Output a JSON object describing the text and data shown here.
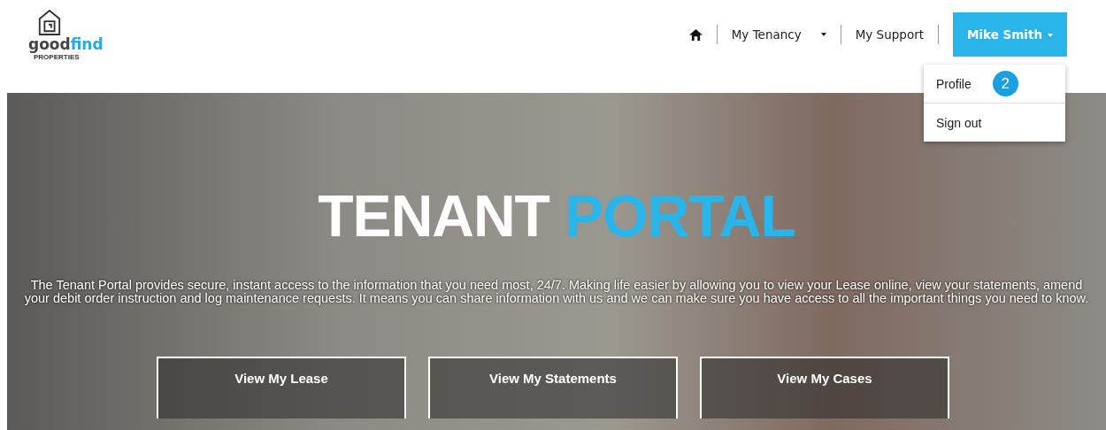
{
  "logo": {
    "word_dark": "good",
    "word_accent": "find",
    "tagline": "PROPERTIES"
  },
  "nav": {
    "items": [
      {
        "label": "My Tenancy",
        "dropdown": true
      },
      {
        "label": "My Support",
        "dropdown": false
      }
    ],
    "user": {
      "label": "Mike Smith",
      "expanded": true
    }
  },
  "user_menu": {
    "items": [
      {
        "label": "Profile",
        "badge": "2"
      },
      {
        "label": "Sign out"
      }
    ]
  },
  "hero": {
    "title_main": "TENANT",
    "title_accent": "PORTAL",
    "description": "The Tenant Portal provides secure, instant access to the information that you need most, 24/7. Making life easier by allowing you to view your Lease online, view your statements, amend your debit order instruction and log maintenance requests. It means you can share information with us and we can make sure you have access to all the important things you need to know.",
    "cards": [
      {
        "title": "View My Lease"
      },
      {
        "title": "View My Statements"
      },
      {
        "title": "View My Cases"
      }
    ]
  }
}
